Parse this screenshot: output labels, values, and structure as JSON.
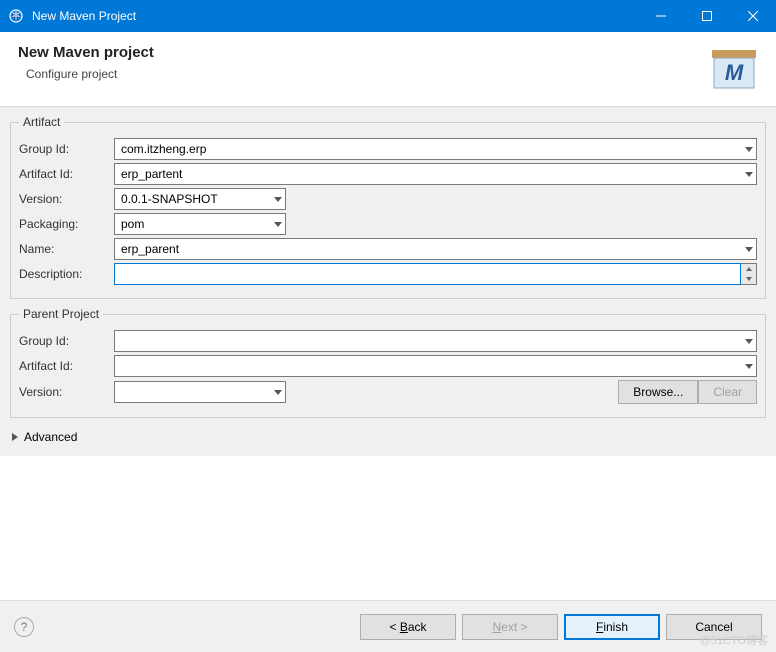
{
  "window": {
    "title": "New Maven Project"
  },
  "header": {
    "title": "New Maven project",
    "subtitle": "Configure project"
  },
  "artifact": {
    "legend": "Artifact",
    "labels": {
      "groupId": "Group Id:",
      "artifactId": "Artifact Id:",
      "version": "Version:",
      "packaging": "Packaging:",
      "name": "Name:",
      "description": "Description:"
    },
    "values": {
      "groupId": "com.itzheng.erp",
      "artifactId": "erp_partent",
      "version": "0.0.1-SNAPSHOT",
      "packaging": "pom",
      "name": "erp_parent",
      "description": ""
    }
  },
  "parent": {
    "legend": "Parent Project",
    "labels": {
      "groupId": "Group Id:",
      "artifactId": "Artifact Id:",
      "version": "Version:"
    },
    "values": {
      "groupId": "",
      "artifactId": "",
      "version": ""
    },
    "buttons": {
      "browse": "Browse...",
      "clear": "Clear"
    }
  },
  "advanced": {
    "label": "Advanced"
  },
  "footer": {
    "back": "< Back",
    "next": "Next >",
    "finish": "Finish",
    "cancel": "Cancel"
  },
  "watermark": "@51CTO博客"
}
